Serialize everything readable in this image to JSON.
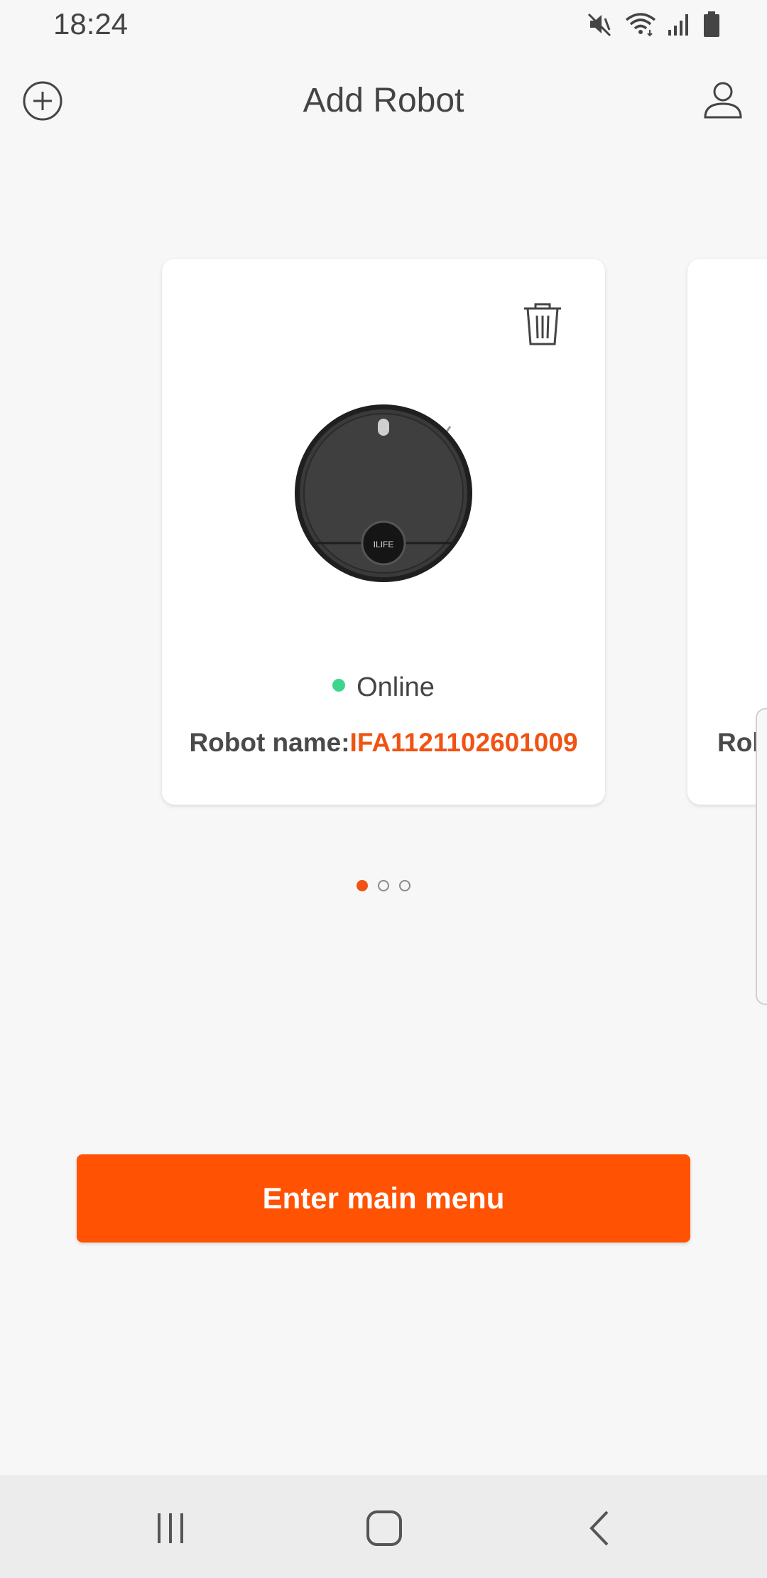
{
  "status_bar": {
    "time": "18:24",
    "icons": [
      "mute-icon",
      "wifi-icon",
      "signal-icon",
      "battery-icon"
    ]
  },
  "header": {
    "title": "Add Robot",
    "left_icon": "add-circle-icon",
    "right_icon": "profile-icon"
  },
  "robot_card": {
    "status": "Online",
    "status_color": "#3dd68c",
    "name_label": "Robot name:",
    "name_value": "IFA1121102601009",
    "brand": "ILIFE",
    "delete_icon": "trash-icon"
  },
  "next_card": {
    "name_label_partial": "Rob"
  },
  "pagination": {
    "count": 3,
    "active_index": 0
  },
  "cta": {
    "label": "Enter main menu"
  },
  "colors": {
    "accent": "#ff5202",
    "name_value": "#f05313",
    "background": "#f7f7f7"
  },
  "nav_bar": {
    "icons": [
      "recents-icon",
      "home-icon",
      "back-icon"
    ]
  }
}
